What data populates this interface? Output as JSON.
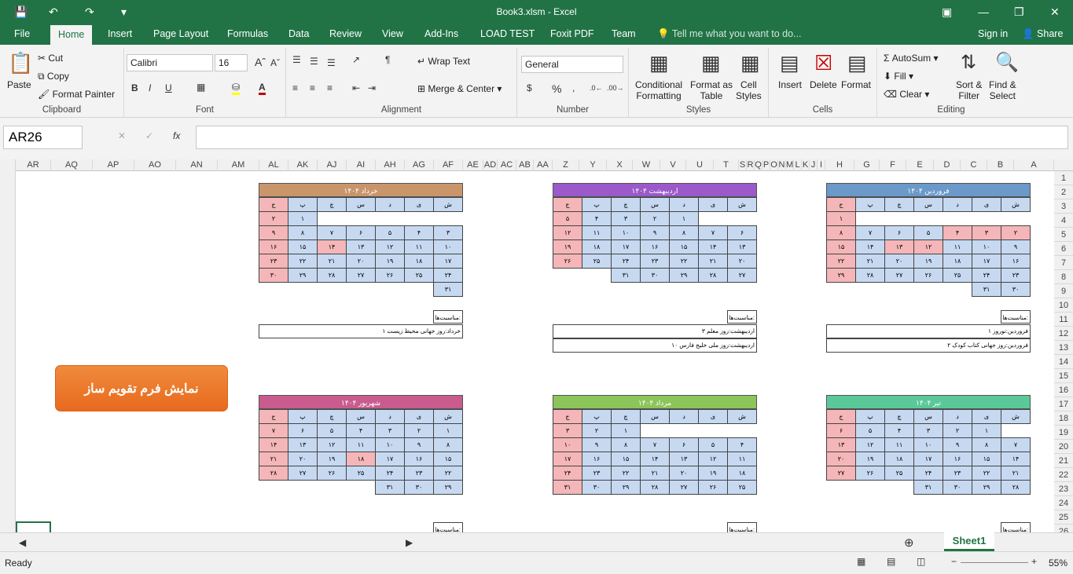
{
  "titlebar": {
    "title": "Book3.xlsm - Excel"
  },
  "tabs": [
    "File",
    "Home",
    "Insert",
    "Page Layout",
    "Formulas",
    "Data",
    "Review",
    "View",
    "Add-Ins",
    "LOAD TEST",
    "Foxit PDF",
    "Team"
  ],
  "tell_me": "Tell me what you want to do...",
  "account": {
    "signin": "Sign in",
    "share": "Share"
  },
  "ribbon": {
    "clipboard": {
      "paste": "Paste",
      "cut": "Cut",
      "copy": "Copy",
      "format_painter": "Format Painter",
      "label": "Clipboard"
    },
    "font": {
      "name": "Calibri",
      "size": "16",
      "label": "Font"
    },
    "alignment": {
      "wrap": "Wrap Text",
      "merge": "Merge & Center",
      "label": "Alignment"
    },
    "number": {
      "format": "General",
      "label": "Number"
    },
    "styles": {
      "conditional": "Conditional",
      "conditional2": "Formatting",
      "format_as": "Format as",
      "format_as2": "Table",
      "cell_styles": "Cell",
      "cell_styles2": "Styles",
      "label": "Styles"
    },
    "cells": {
      "insert": "Insert",
      "delete": "Delete",
      "format": "Format",
      "label": "Cells"
    },
    "editing": {
      "autosum": "AutoSum",
      "fill": "Fill",
      "clear": "Clear",
      "sort": "Sort &",
      "sort2": "Filter",
      "find": "Find &",
      "find2": "Select",
      "label": "Editing"
    }
  },
  "namebox": "AR26",
  "fx": "fx",
  "columns": [
    "AR",
    "AQ",
    "AP",
    "AO",
    "AN",
    "AM",
    "AL",
    "AK",
    "AJ",
    "AI",
    "AH",
    "AG",
    "AF",
    "AE",
    "AD",
    "AC",
    "AB",
    "AA",
    "Z",
    "Y",
    "X",
    "W",
    "V",
    "U",
    "T",
    "S",
    "R",
    "Q",
    "P",
    "O",
    "N",
    "M",
    "L",
    "K",
    "J",
    "I",
    "H",
    "G",
    "F",
    "E",
    "D",
    "C",
    "B",
    "A"
  ],
  "rows": [
    "1",
    "2",
    "3",
    "4",
    "5",
    "6",
    "7",
    "8",
    "9",
    "10",
    "11",
    "12",
    "13",
    "14",
    "15",
    "16",
    "17",
    "18",
    "19",
    "20",
    "21",
    "22",
    "23",
    "24",
    "25",
    "26"
  ],
  "weekdays": [
    "ش",
    "ی",
    "د",
    "س",
    "چ",
    "پ",
    "ج"
  ],
  "calendars": [
    {
      "title": "فروردین ۱۴۰۴",
      "color": "#6b99c9",
      "weeks": [
        [
          "",
          "",
          "",
          "",
          "",
          "",
          "۱"
        ],
        [
          "۲",
          "۳",
          "۴",
          "۵",
          "۶",
          "۷",
          "۸"
        ],
        [
          "۹",
          "۱۰",
          "۱۱",
          "۱۲",
          "۱۳",
          "۱۴",
          "۱۵"
        ],
        [
          "۱۶",
          "۱۷",
          "۱۸",
          "۱۹",
          "۲۰",
          "۲۱",
          "۲۲"
        ],
        [
          "۲۳",
          "۲۴",
          "۲۵",
          "۲۶",
          "۲۷",
          "۲۸",
          "۲۹"
        ],
        [
          "۳۰",
          "۳۱",
          "",
          "",
          "",
          "",
          ""
        ]
      ],
      "holidays": [
        [
          0,
          6
        ],
        [
          1,
          0
        ],
        [
          1,
          1
        ],
        [
          1,
          2
        ],
        [
          1,
          6
        ],
        [
          2,
          3
        ],
        [
          2,
          4
        ],
        [
          2,
          6
        ],
        [
          3,
          6
        ],
        [
          4,
          6
        ]
      ]
    },
    {
      "title": "اردیبهشت ۱۴۰۴",
      "color": "#9b59c9",
      "weeks": [
        [
          "",
          "",
          "۱",
          "۲",
          "۳",
          "۴",
          "۵"
        ],
        [
          "۶",
          "۷",
          "۸",
          "۹",
          "۱۰",
          "۱۱",
          "۱۲"
        ],
        [
          "۱۳",
          "۱۴",
          "۱۵",
          "۱۶",
          "۱۷",
          "۱۸",
          "۱۹"
        ],
        [
          "۲۰",
          "۲۱",
          "۲۲",
          "۲۳",
          "۲۴",
          "۲۵",
          "۲۶"
        ],
        [
          "۲۷",
          "۲۸",
          "۲۹",
          "۳۰",
          "۳۱",
          "",
          ""
        ]
      ],
      "holidays": [
        [
          0,
          6
        ],
        [
          1,
          6
        ],
        [
          2,
          6
        ],
        [
          3,
          6
        ]
      ]
    },
    {
      "title": "خرداد ۱۴۰۴",
      "color": "#c9956b",
      "weeks": [
        [
          "",
          "",
          "",
          "",
          "",
          "۱",
          "۲"
        ],
        [
          "۳",
          "۴",
          "۵",
          "۶",
          "۷",
          "۸",
          "۹"
        ],
        [
          "۱۰",
          "۱۱",
          "۱۲",
          "۱۳",
          "۱۴",
          "۱۵",
          "۱۶"
        ],
        [
          "۱۷",
          "۱۸",
          "۱۹",
          "۲۰",
          "۲۱",
          "۲۲",
          "۲۳"
        ],
        [
          "۲۴",
          "۲۵",
          "۲۶",
          "۲۷",
          "۲۸",
          "۲۹",
          "۳۰"
        ],
        [
          "۳۱",
          "",
          "",
          "",
          "",
          "",
          ""
        ]
      ],
      "holidays": [
        [
          0,
          6
        ],
        [
          1,
          6
        ],
        [
          2,
          4
        ],
        [
          2,
          6
        ],
        [
          3,
          6
        ],
        [
          4,
          6
        ]
      ]
    },
    {
      "title": "تیر ۱۴۰۴",
      "color": "#5bc89a",
      "weeks": [
        [
          "",
          "۱",
          "۲",
          "۳",
          "۴",
          "۵",
          "۶"
        ],
        [
          "۷",
          "۸",
          "۹",
          "۱۰",
          "۱۱",
          "۱۲",
          "۱۳"
        ],
        [
          "۱۴",
          "۱۵",
          "۱۶",
          "۱۷",
          "۱۸",
          "۱۹",
          "۲۰"
        ],
        [
          "۲۱",
          "۲۲",
          "۲۳",
          "۲۴",
          "۲۵",
          "۲۶",
          "۲۷"
        ],
        [
          "۲۸",
          "۲۹",
          "۳۰",
          "۳۱",
          "",
          "",
          ""
        ]
      ],
      "holidays": [
        [
          0,
          6
        ],
        [
          1,
          6
        ],
        [
          2,
          6
        ],
        [
          3,
          6
        ]
      ]
    },
    {
      "title": "مرداد ۱۴۰۴",
      "color": "#8cc55a",
      "weeks": [
        [
          "",
          "",
          "",
          "",
          "۱",
          "۲",
          "۳"
        ],
        [
          "۴",
          "۵",
          "۶",
          "۷",
          "۸",
          "۹",
          "۱۰"
        ],
        [
          "۱۱",
          "۱۲",
          "۱۳",
          "۱۴",
          "۱۵",
          "۱۶",
          "۱۷"
        ],
        [
          "۱۸",
          "۱۹",
          "۲۰",
          "۲۱",
          "۲۲",
          "۲۳",
          "۲۴"
        ],
        [
          "۲۵",
          "۲۶",
          "۲۷",
          "۲۸",
          "۲۹",
          "۳۰",
          "۳۱"
        ]
      ],
      "holidays": [
        [
          0,
          6
        ],
        [
          1,
          6
        ],
        [
          2,
          6
        ],
        [
          3,
          6
        ],
        [
          4,
          6
        ]
      ]
    },
    {
      "title": "شهریور ۱۴۰۴",
      "color": "#c95b8f",
      "weeks": [
        [
          "۱",
          "۲",
          "۳",
          "۴",
          "۵",
          "۶",
          "۷"
        ],
        [
          "۸",
          "۹",
          "۱۰",
          "۱۱",
          "۱۲",
          "۱۳",
          "۱۴"
        ],
        [
          "۱۵",
          "۱۶",
          "۱۷",
          "۱۸",
          "۱۹",
          "۲۰",
          "۲۱"
        ],
        [
          "۲۲",
          "۲۳",
          "۲۴",
          "۲۵",
          "۲۶",
          "۲۷",
          "۲۸"
        ],
        [
          "۲۹",
          "۳۰",
          "۳۱",
          "",
          "",
          "",
          ""
        ]
      ],
      "holidays": [
        [
          0,
          6
        ],
        [
          1,
          6
        ],
        [
          2,
          3
        ],
        [
          2,
          6
        ],
        [
          3,
          6
        ]
      ]
    }
  ],
  "occasions_label": "مناسبت‌ها:",
  "occasions": [
    [
      "فروردین:نوروز ۱",
      "فروردین:روز جهانی کتاب کودک ۲"
    ],
    [
      "اردیبهشت:روز معلم ۳",
      "اردیبهشت:روز ملی خلیج فارس ۱۰"
    ],
    [
      "خرداد:روز جهانی محیط زیست ۱"
    ]
  ],
  "button": "نمایش فرم تقویم ساز",
  "sheet": "Sheet1",
  "status": {
    "ready": "Ready",
    "zoom": "55%"
  }
}
